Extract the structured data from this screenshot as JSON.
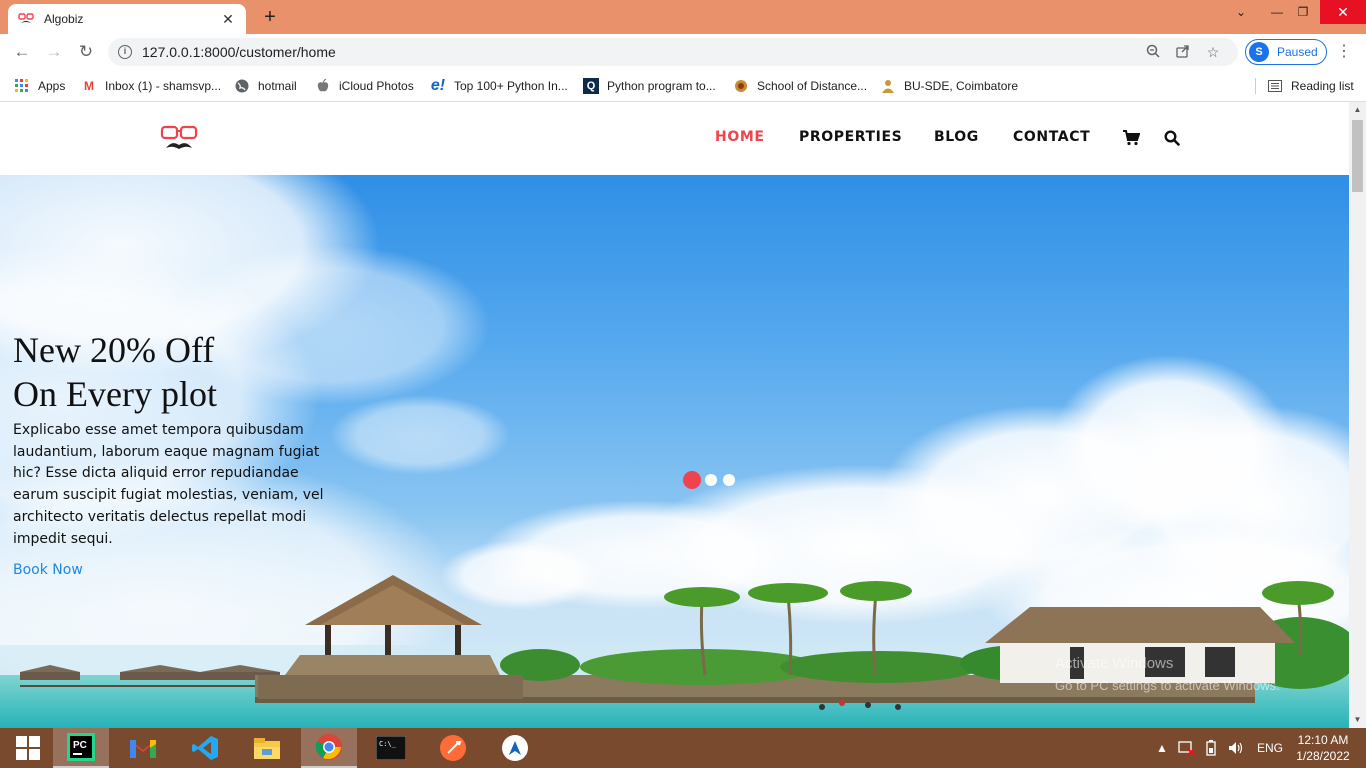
{
  "browser": {
    "tab_title": "Algobiz",
    "url": "127.0.0.1:8000/customer/home",
    "profile_initial": "S",
    "profile_status": "Paused"
  },
  "bookmarks": [
    {
      "label": "Apps",
      "icon": "apps-grid-icon"
    },
    {
      "label": "Inbox (1) - shamsvp...",
      "icon": "gmail-icon"
    },
    {
      "label": "hotmail",
      "icon": "globe-icon"
    },
    {
      "label": "iCloud Photos",
      "icon": "apple-icon"
    },
    {
      "label": "Top 100+ Python In...",
      "icon": "e-icon"
    },
    {
      "label": "Python program to...",
      "icon": "q-icon"
    },
    {
      "label": "School of Distance...",
      "icon": "emblem-icon"
    },
    {
      "label": "BU-SDE, Coimbatore",
      "icon": "person-icon"
    }
  ],
  "reading_list": "Reading list",
  "site": {
    "nav": [
      "HOME",
      "PROPERTIES",
      "BLOG",
      "CONTACT"
    ],
    "active_nav": "HOME",
    "accent": "#F0434D"
  },
  "hero": {
    "title_line1": "New 20% Off",
    "title_line2": "On Every plot",
    "description": "Explicabo esse amet tempora quibusdam laudantium, laborum eaque magnam fugiat hic? Esse dicta aliquid error repudiandae earum suscipit fugiat molestias, veniam, vel architecto veritatis delectus repellat modi impedit sequi.",
    "cta": "Book Now",
    "slide_count": 3,
    "active_slide": 1
  },
  "watermark": {
    "line1": "Activate Windows",
    "line2": "Go to PC settings to activate Windows."
  },
  "taskbar": {
    "lang": "ENG",
    "time": "12:10 AM",
    "date": "1/28/2022"
  }
}
